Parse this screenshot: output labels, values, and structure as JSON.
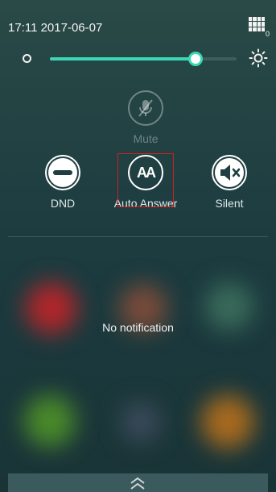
{
  "status_bar": {
    "datetime": "17:11 2017-06-07",
    "dialpad_badge": "0"
  },
  "brightness": {
    "level_fraction": 0.78,
    "accent_color": "#3ad8b6",
    "low_icon": "brightness-low-icon",
    "high_icon": "brightness-high-icon"
  },
  "toggles": {
    "mute": {
      "label": "Mute",
      "icon": "mic-off-icon",
      "enabled": false
    },
    "dnd": {
      "label": "DND",
      "icon": "do-not-disturb-icon"
    },
    "auto_answer": {
      "label": "Auto Answer",
      "icon": "auto-answer-icon",
      "icon_text": "AA",
      "highlighted": true
    },
    "silent": {
      "label": "Silent",
      "icon": "speaker-mute-icon"
    }
  },
  "notifications": {
    "empty_text": "No notification"
  },
  "bottom": {
    "handle_icon": "double-chevron-up-icon"
  },
  "colors": {
    "highlight_box": "#d11f1f"
  }
}
